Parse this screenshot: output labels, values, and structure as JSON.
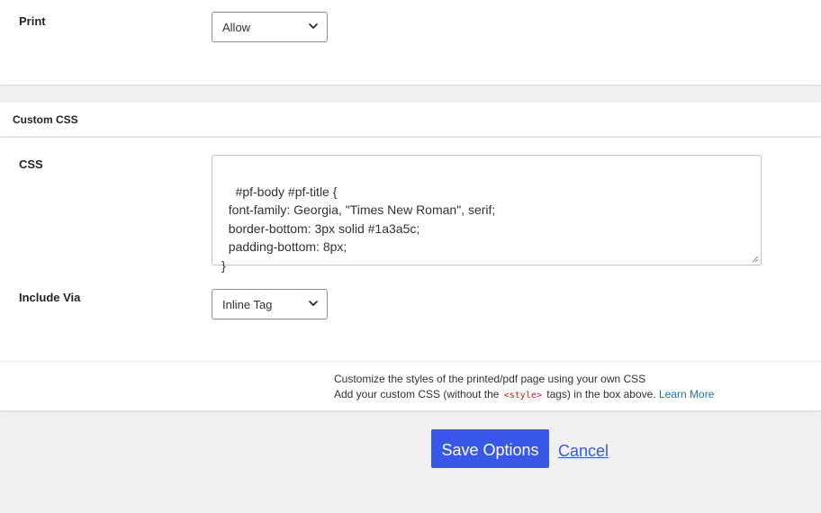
{
  "print_panel": {
    "label": "Print",
    "select_value": "Allow"
  },
  "custom_css": {
    "section_title": "Custom CSS",
    "css_label": "CSS",
    "css_value": "#pf-body #pf-title {\n  font-family: Georgia, \"Times New Roman\", serif;\n  border-bottom: 3px solid #1a3a5c;\n  padding-bottom: 8px;\n}",
    "include_label": "Include Via",
    "include_value": "Inline Tag",
    "help_line1": "Customize the styles of the printed/pdf page using your own CSS",
    "help_line2_before": "Add your custom CSS (without the ",
    "help_line2_code": "<style>",
    "help_line2_after": " tags) in the box above. ",
    "help_link": "Learn More"
  },
  "actions": {
    "save_label": "Save Options",
    "cancel_label": "Cancel"
  },
  "colors": {
    "accent": "#3858e9",
    "link": "#2271b1",
    "code": "#b32d2e"
  },
  "icons": {
    "dropdown": "chevron-down-icon",
    "resize": "resize-grip-icon"
  }
}
